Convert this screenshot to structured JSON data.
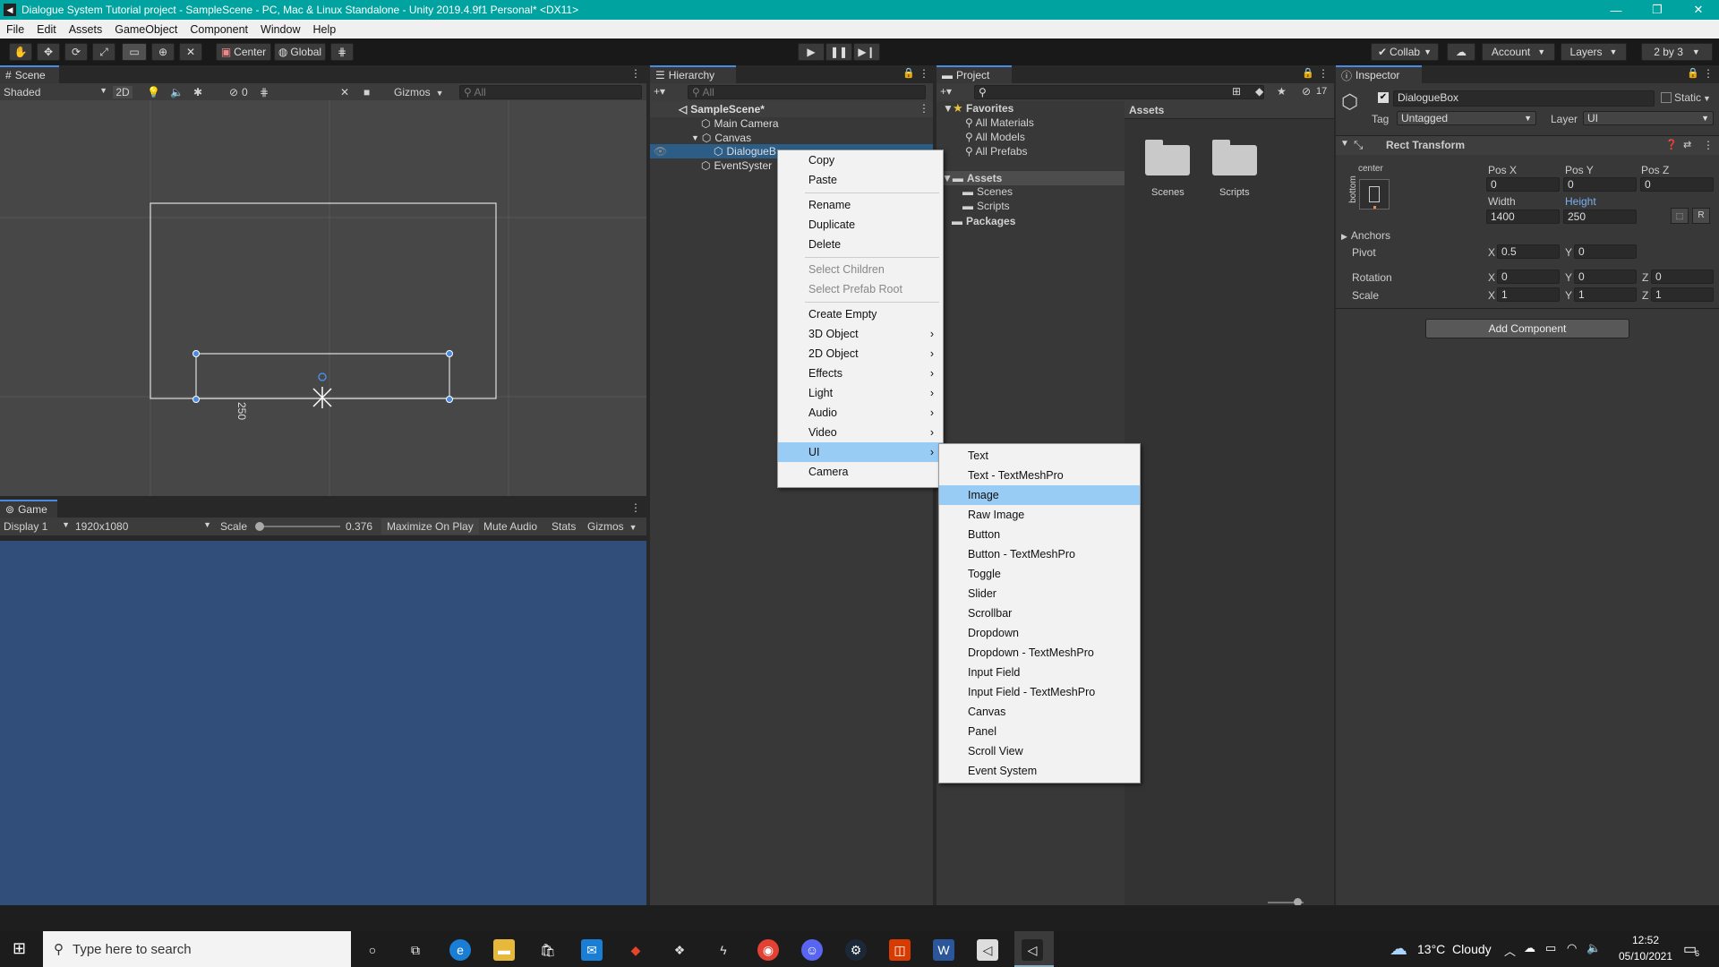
{
  "window": {
    "title": "Dialogue System Tutorial project - SampleScene - PC, Mac & Linux Standalone - Unity 2019.4.9f1 Personal* <DX11>",
    "controls": [
      "—",
      "❐",
      "✕"
    ]
  },
  "menubar": [
    "File",
    "Edit",
    "Assets",
    "GameObject",
    "Component",
    "Window",
    "Help"
  ],
  "toolbar": {
    "pivot": "Center",
    "space": "Global",
    "collab": "Collab",
    "account": "Account",
    "layers": "Layers",
    "layout": "2 by 3"
  },
  "scene": {
    "tab": "Scene",
    "shading": "Shaded",
    "mode2d": "2D",
    "hidden_count": "0",
    "gizmos": "Gizmos",
    "search_placeholder": "All",
    "dimension_label": "250"
  },
  "game": {
    "tab": "Game",
    "display": "Display 1",
    "resolution": "1920x1080",
    "scale_label": "Scale",
    "scale_value": "0.376",
    "maximize": "Maximize On Play",
    "mute": "Mute Audio",
    "stats": "Stats",
    "gizmos": "Gizmos",
    "background_color": "#314d79"
  },
  "hierarchy": {
    "tab": "Hierarchy",
    "search_placeholder": "All",
    "items": [
      {
        "label": "SampleScene*",
        "indent": 0
      },
      {
        "label": "Main Camera",
        "indent": 1
      },
      {
        "label": "Canvas",
        "indent": 1
      },
      {
        "label": "DialogueB",
        "indent": 2,
        "selected": true
      },
      {
        "label": "EventSyster",
        "indent": 1
      }
    ]
  },
  "project": {
    "tab": "Project",
    "hidden_count": "17",
    "favorites": {
      "label": "Favorites",
      "items": [
        "All Materials",
        "All Models",
        "All Prefabs"
      ]
    },
    "assets_label": "Assets",
    "asset_folders": [
      "Scenes",
      "Scripts"
    ],
    "packages_label": "Packages",
    "breadcrumb": "Assets",
    "grid_items": [
      "Scenes",
      "Scripts"
    ]
  },
  "inspector": {
    "tab": "Inspector",
    "object_name": "DialogueBox",
    "static_label": "Static",
    "tag_label": "Tag",
    "tag_value": "Untagged",
    "layer_label": "Layer",
    "layer_value": "UI",
    "component": "Rect Transform",
    "anchor_h": "center",
    "anchor_v": "bottom",
    "pos_labels": [
      "Pos X",
      "Pos Y",
      "Pos Z"
    ],
    "pos_values": [
      "0",
      "0",
      "0"
    ],
    "width_label": "Width",
    "height_label": "Height",
    "width_value": "1400",
    "height_value": "250",
    "anchors_label": "Anchors",
    "pivot_label": "Pivot",
    "pivot": {
      "x": "0.5",
      "y": "0"
    },
    "rotation_label": "Rotation",
    "rotation": {
      "x": "0",
      "y": "0",
      "z": "0"
    },
    "scale_label": "Scale",
    "scale": {
      "x": "1",
      "y": "1",
      "z": "1"
    },
    "add_component": "Add Component",
    "r_button": "R"
  },
  "context_menu": {
    "items": [
      {
        "label": "Copy"
      },
      {
        "label": "Paste"
      },
      {
        "label": "Rename"
      },
      {
        "label": "Duplicate"
      },
      {
        "label": "Delete"
      },
      {
        "label": "Select Children",
        "disabled": true
      },
      {
        "label": "Select Prefab Root",
        "disabled": true
      },
      {
        "label": "Create Empty"
      },
      {
        "label": "3D Object",
        "submenu": true
      },
      {
        "label": "2D Object",
        "submenu": true
      },
      {
        "label": "Effects",
        "submenu": true
      },
      {
        "label": "Light",
        "submenu": true
      },
      {
        "label": "Audio",
        "submenu": true
      },
      {
        "label": "Video",
        "submenu": true
      },
      {
        "label": "UI",
        "submenu": true,
        "active": true
      },
      {
        "label": "Camera"
      }
    ],
    "ui_submenu": [
      "Text",
      "Text - TextMeshPro",
      "Image",
      "Raw Image",
      "Button",
      "Button - TextMeshPro",
      "Toggle",
      "Slider",
      "Scrollbar",
      "Dropdown",
      "Dropdown - TextMeshPro",
      "Input Field",
      "Input Field - TextMeshPro",
      "Canvas",
      "Panel",
      "Scroll View",
      "Event System"
    ],
    "ui_submenu_highlight": "Image"
  },
  "taskbar": {
    "search_placeholder": "Type here to search",
    "weather": "13°C  Cloudy",
    "time": "12:52",
    "date": "05/10/2021",
    "notifications": "6"
  }
}
